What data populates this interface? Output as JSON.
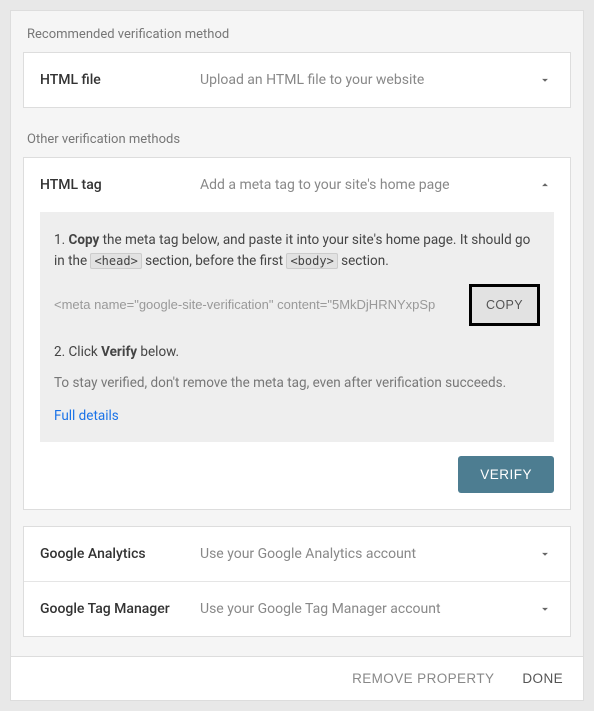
{
  "sections": {
    "recommended_label": "Recommended verification method",
    "other_label": "Other verification methods"
  },
  "html_file": {
    "title": "HTML file",
    "subtitle": "Upload an HTML file to your website"
  },
  "html_tag": {
    "title": "HTML tag",
    "subtitle": "Add a meta tag to your site's home page",
    "step1_prefix": "1. ",
    "step1_bold": "Copy",
    "step1_text_a": " the meta tag below, and paste it into your site's home page. It should go in the ",
    "step1_code_a": "<head>",
    "step1_text_b": " section, before the first ",
    "step1_code_b": "<body>",
    "step1_text_c": " section.",
    "meta_snippet": "<meta name=\"google-site-verification\" content=\"5MkDjHRNYxpSp",
    "copy_label": "COPY",
    "step2_prefix": "2. Click ",
    "step2_bold": "Verify",
    "step2_suffix": " below.",
    "note": "To stay verified, don't remove the meta tag, even after verification succeeds.",
    "details_link": "Full details",
    "verify_label": "VERIFY"
  },
  "google_analytics": {
    "title": "Google Analytics",
    "subtitle": "Use your Google Analytics account"
  },
  "google_tag_manager": {
    "title": "Google Tag Manager",
    "subtitle": "Use your Google Tag Manager account"
  },
  "footer": {
    "remove": "REMOVE PROPERTY",
    "done": "DONE"
  }
}
